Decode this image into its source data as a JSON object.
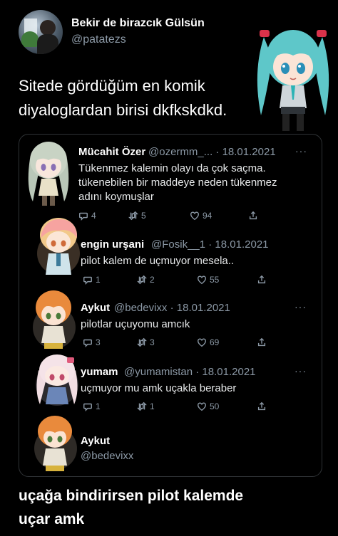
{
  "tweet": {
    "author_name": "Bekir de birazcık Gülsün",
    "author_handle": "@patatezs",
    "text_line1": "Sitede gördüğüm en komik",
    "text_line2": "diyaloglardan birisi dkfkskdkd."
  },
  "replies": [
    {
      "name": "Mücahit Özer",
      "handle": "@ozermm_...",
      "date": "· 18.01.2021",
      "lines": [
        "Tükenmez kalemin olayı da çok saçma.",
        "tükenebilen bir maddeye neden tükenmez",
        "adını koymuşlar"
      ],
      "reply_count": "4",
      "retweet_count": "5",
      "like_count": "94"
    },
    {
      "name": "engin urşani",
      "handle": "@Fosik__1",
      "date": "· 18.01.2021",
      "lines": [
        "pilot kalem de uçmuyor mesela.."
      ],
      "reply_count": "1",
      "retweet_count": "2",
      "like_count": "55"
    },
    {
      "name": "Aykut",
      "handle": "@bedevixx",
      "date": "· 18.01.2021",
      "lines": [
        "pilotlar uçuyomu amcık"
      ],
      "reply_count": "3",
      "retweet_count": "3",
      "like_count": "69"
    },
    {
      "name": "yumam",
      "handle": "@yumamistan",
      "date": "· 18.01.2021",
      "lines": [
        "uçmuyor mu amk uçakla beraber"
      ],
      "reply_count": "1",
      "retweet_count": "1",
      "like_count": "50"
    }
  ],
  "last_author": {
    "name": "Aykut",
    "handle": "@bedevixx",
    "text_line1": "uçağa bindirirsen pilot kalemde",
    "text_line2": "uçar amk"
  },
  "more_glyph": "···",
  "icons": [
    "reply-icon",
    "retweet-icon",
    "like-icon",
    "share-icon"
  ],
  "colors": {
    "background": "#000000",
    "secondary_text": "#8b98a5",
    "border": "#2f3336"
  }
}
